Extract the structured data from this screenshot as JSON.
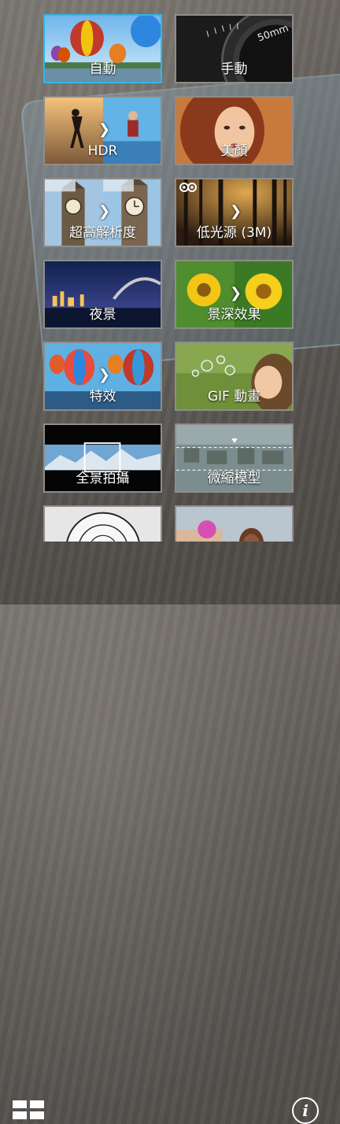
{
  "modes": [
    {
      "key": "auto",
      "label": "自動",
      "selected": true
    },
    {
      "key": "manual",
      "label": "手動",
      "selected": false
    },
    {
      "key": "hdr",
      "label": "HDR",
      "selected": false
    },
    {
      "key": "beautification",
      "label": "美顏",
      "selected": false
    },
    {
      "key": "super-resolution",
      "label": "超高解析度",
      "selected": false
    },
    {
      "key": "low-light",
      "label": "低光源 (3M)",
      "selected": false
    },
    {
      "key": "night",
      "label": "夜景",
      "selected": false
    },
    {
      "key": "depth-of-field",
      "label": "景深效果",
      "selected": false
    },
    {
      "key": "effect",
      "label": "特效",
      "selected": false
    },
    {
      "key": "gif",
      "label": "GIF 動畫",
      "selected": false
    },
    {
      "key": "panorama",
      "label": "全景拍攝",
      "selected": false
    },
    {
      "key": "miniature",
      "label": "微縮模型",
      "selected": false
    },
    {
      "key": "time-rewind",
      "label": "",
      "selected": false
    },
    {
      "key": "selfie",
      "label": "",
      "selected": false
    }
  ],
  "lens_text": "50mm",
  "footer": {
    "grid_icon": "grid-view-icon",
    "info_icon": "info-icon",
    "info_glyph": "i"
  },
  "colors": {
    "selected_border": "#2fb8e8",
    "tile_border": "#8f8d8b"
  }
}
